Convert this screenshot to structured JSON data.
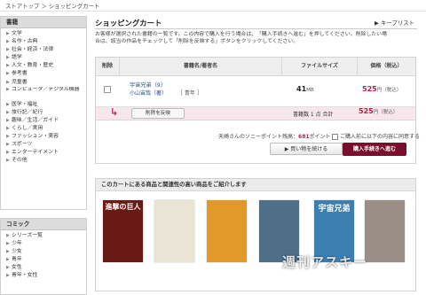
{
  "breadcrumb": {
    "path": "ストアトップ ＞ ショッピングカート"
  },
  "sidebar": {
    "books_heading": "書籍",
    "books": [
      "文学",
      "名作・古典",
      "社会・経済・法律",
      "語学",
      "人文・教育・歴史",
      "参考書",
      "児童書",
      "コンピュータ／デジタル機器",
      "医学・福祉",
      "旅行記／紀行",
      "趣味／生活／ガイド",
      "くらし／実用",
      "ファッション・美容",
      "スポーツ",
      "エンターテイメント",
      "その他"
    ],
    "comics_heading": "コミック",
    "comics": [
      "シリーズ一覧",
      "少年",
      "少女",
      "青年",
      "女性",
      "青年・女性"
    ]
  },
  "page": {
    "title": "ショッピングカート",
    "wishlist": "キープリスト",
    "description": "お客様が選択された書籍の一覧です。この内容で購入を行う場合は、「購入手続きへ進む」を押してください。削除したい場合は、該当の作品をチェックして「削除を反映する」ボタンをクリックしてください。"
  },
  "cart": {
    "headers": {
      "delete": "削除",
      "title_author": "書籍名/著者名",
      "file_size": "ファイルサイズ",
      "price": "価格（税込）"
    },
    "item": {
      "title": "宇宙兄弟（9）",
      "author": "小山宙哉（著）",
      "genre": "［ 青年 ］",
      "file_size": "41",
      "file_size_unit": "MB",
      "price": "525",
      "price_unit": "円",
      "price_tax": "（税込）"
    },
    "remove_button": "削除を反映",
    "summary_label": "書籍数 1 点 合計",
    "summary_price": "525",
    "summary_unit": "円",
    "summary_tax": "（税込）",
    "points_prefix": "天崎さんのソニーポイント残高：",
    "points_value": "681",
    "points_suffix": "ポイント",
    "agree_text": "ご購入前に以下の内容に同意する",
    "continue_button": "▶ 買い物を続ける",
    "checkout_button": "購入手続きへ進む"
  },
  "related": {
    "heading": "このカートにある商品と関連性の高い商品をご紹介します",
    "covers": [
      {
        "title": "進撃の巨人",
        "bg": "#6a1a14",
        "fg": "#ffffff"
      },
      {
        "title": "",
        "bg": "#e9e4d6",
        "fg": "#333333"
      },
      {
        "title": "",
        "bg": "#e19a2a",
        "fg": "#ffffff"
      },
      {
        "title": "",
        "bg": "#4f6f88",
        "fg": "#ffffff"
      },
      {
        "title": "宇宙兄弟",
        "bg": "#3c7fb0",
        "fg": "#ffffff"
      },
      {
        "title": "",
        "bg": "#9a8e86",
        "fg": "#ffffff"
      }
    ],
    "watermark": "週刊アスキー"
  }
}
